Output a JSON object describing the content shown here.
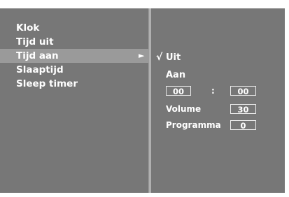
{
  "menu": {
    "items": [
      {
        "label": "Klok"
      },
      {
        "label": "Tijd uit"
      },
      {
        "label": "Tijd aan",
        "selected": true
      },
      {
        "label": "Slaaptijd"
      },
      {
        "label": "Sleep timer"
      }
    ],
    "submenu_arrow": "►"
  },
  "submenu": {
    "check_mark": "√",
    "option_uit": "Uit",
    "option_aan": "Aan",
    "hour": "00",
    "separator": ":",
    "minute": "00",
    "volume_label": "Volume",
    "volume_value": "30",
    "programma_label": "Programma",
    "programma_value": "0"
  },
  "colors": {
    "panel_bg": "#777777",
    "selected_bg": "#9a9a9a",
    "text": "#ffffff",
    "divider": "#b0b0b0"
  }
}
